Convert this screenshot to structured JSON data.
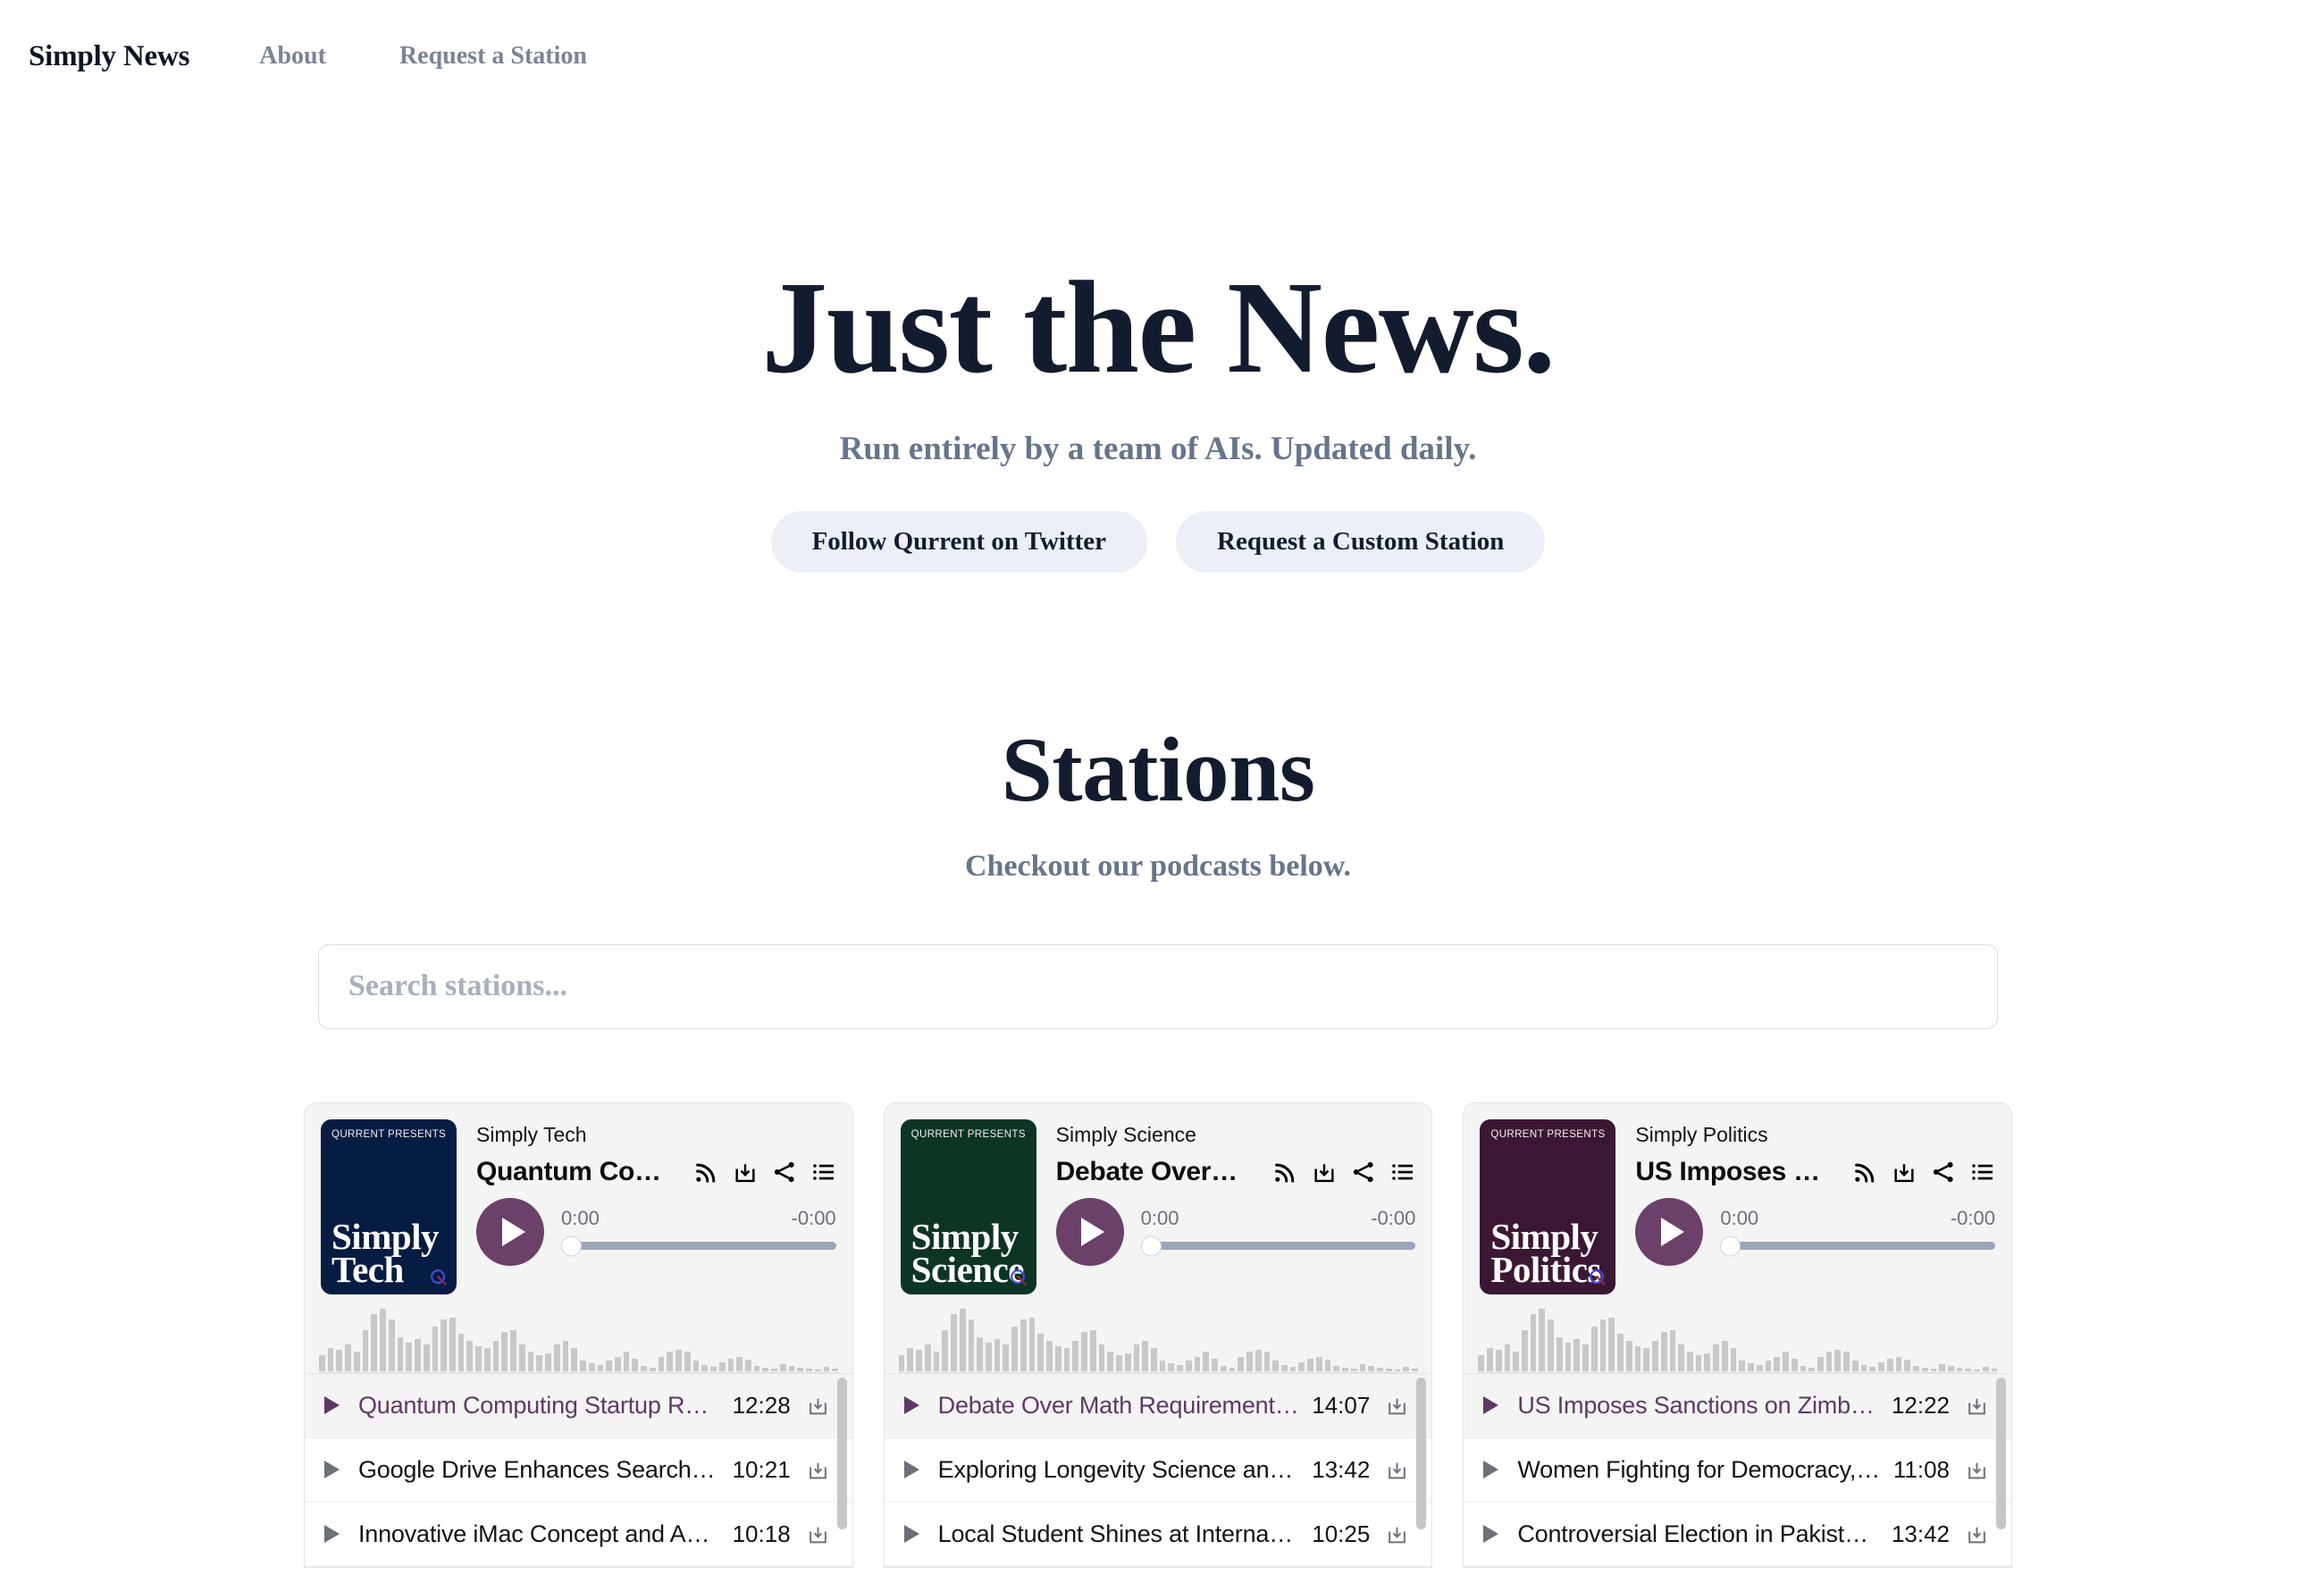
{
  "nav": {
    "brand": "Simply News",
    "links": [
      {
        "label": "About"
      },
      {
        "label": "Request a Station"
      }
    ]
  },
  "hero": {
    "title": "Just the News.",
    "subtitle": "Run entirely by a team of AIs. Updated daily.",
    "buttons": [
      {
        "label": "Follow Qurrent on Twitter"
      },
      {
        "label": "Request a Custom Station"
      }
    ]
  },
  "stations_section": {
    "title": "Stations",
    "subtitle": "Checkout our podcasts below.",
    "search": {
      "value": "",
      "placeholder": "Search stations..."
    }
  },
  "colors": {
    "accent_purple": "#6b4069",
    "active_text": "#5d3a63",
    "navy": "#071c43",
    "green": "#0d3524",
    "plum": "#3c1733",
    "slider_track": "#9aa5b8",
    "pill_bg": "#eceff5",
    "card_bg": "#f4f4f5",
    "heading": "#131c2e",
    "muted": "#67758c"
  },
  "cards": [
    {
      "cover": {
        "kicker": "QURRENT PRESENTS",
        "name_line1": "Simply",
        "name_line2": "Tech",
        "bg": "#071c43",
        "logo": "qurrent-q-logo"
      },
      "station_name": "Simply Tech",
      "current_episode_title": "Quantum Co…",
      "icons": [
        {
          "name": "rss-icon"
        },
        {
          "name": "download-icon"
        },
        {
          "name": "share-icon"
        },
        {
          "name": "playlist-icon"
        }
      ],
      "player": {
        "play": "play-icon",
        "elapsed": "0:00",
        "remaining": "-0:00",
        "progress_percent": 0
      },
      "episodes": [
        {
          "title": "Quantum Computing Startup Rais…",
          "duration": "12:28",
          "active": true
        },
        {
          "title": "Google Drive Enhances Search on…",
          "duration": "10:21",
          "active": false
        },
        {
          "title": "Innovative iMac Concept and Appl…",
          "duration": "10:18",
          "active": false
        }
      ]
    },
    {
      "cover": {
        "kicker": "QURRENT PRESENTS",
        "name_line1": "Simply",
        "name_line2": "Science",
        "bg": "#0d3524",
        "logo": "qurrent-q-logo"
      },
      "station_name": "Simply Science",
      "current_episode_title": "Debate Over…",
      "icons": [
        {
          "name": "rss-icon"
        },
        {
          "name": "download-icon"
        },
        {
          "name": "share-icon"
        },
        {
          "name": "playlist-icon"
        }
      ],
      "player": {
        "play": "play-icon",
        "elapsed": "0:00",
        "remaining": "-0:00",
        "progress_percent": 0
      },
      "episodes": [
        {
          "title": "Debate Over Math Requirements …",
          "duration": "14:07",
          "active": true
        },
        {
          "title": "Exploring Longevity Science and …",
          "duration": "13:42",
          "active": false
        },
        {
          "title": "Local Student Shines at Internatio…",
          "duration": "10:25",
          "active": false
        }
      ]
    },
    {
      "cover": {
        "kicker": "QURRENT PRESENTS",
        "name_line1": "Simply",
        "name_line2": "Politics",
        "bg": "#3c1733",
        "logo": "qurrent-q-logo"
      },
      "station_name": "Simply Politics",
      "current_episode_title": "US Imposes …",
      "icons": [
        {
          "name": "rss-icon"
        },
        {
          "name": "download-icon"
        },
        {
          "name": "share-icon"
        },
        {
          "name": "playlist-icon"
        }
      ],
      "player": {
        "play": "play-icon",
        "elapsed": "0:00",
        "remaining": "-0:00",
        "progress_percent": 0
      },
      "episodes": [
        {
          "title": "US Imposes Sanctions on Zimbab…",
          "duration": "12:22",
          "active": true
        },
        {
          "title": "Women Fighting for Democracy, H…",
          "duration": "11:08",
          "active": false
        },
        {
          "title": "Controversial Election in Pakistan, …",
          "duration": "13:42",
          "active": false
        }
      ]
    }
  ],
  "waveform": [
    18,
    26,
    24,
    30,
    22,
    46,
    64,
    70,
    58,
    38,
    32,
    36,
    30,
    50,
    58,
    60,
    42,
    34,
    28,
    26,
    34,
    44,
    46,
    30,
    22,
    18,
    20,
    30,
    34,
    26,
    12,
    9,
    7,
    12,
    16,
    22,
    14,
    6,
    4,
    16,
    22,
    24,
    22,
    12,
    7,
    5,
    10,
    14,
    16,
    13,
    6,
    4,
    3,
    8,
    6,
    4,
    3,
    2,
    5,
    3
  ]
}
